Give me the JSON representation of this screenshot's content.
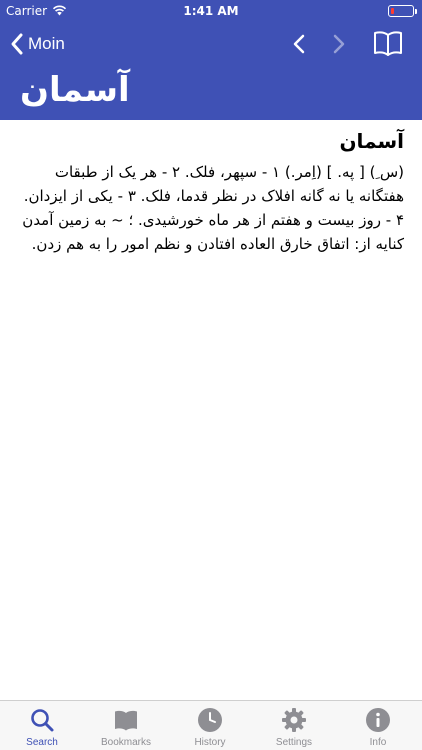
{
  "status_bar": {
    "carrier": "Carrier",
    "time": "1:41 AM",
    "battery_level": 0.15,
    "battery_color": "#ff3b30"
  },
  "nav": {
    "back_label": "Moin",
    "icons": [
      "chevron-left-icon",
      "chevron-left-icon",
      "chevron-right-icon",
      "book-open-icon"
    ]
  },
  "entry": {
    "title": "آسمان",
    "headword": "آسمان",
    "definition": "(س ِ) [ په. ] (اِمر.) ۱ -  سپهر، فلک. ۲ -  هر یک از طبقات هفتگانه یا نه گانه افلاک در نظر قدما، فلک. ۳ -  یکی از ایزدان. ۴ -  روز بیست و هفتم از هر ماه خورشیدی. ؛ ~ به زمین آمدن  کنایه از: اتفاق خارق العاده افتادن و نظم امور را به هم زدن."
  },
  "tabs": [
    {
      "label": "Search",
      "icon": "search-icon",
      "active": true
    },
    {
      "label": "Bookmarks",
      "icon": "bookmarks-icon",
      "active": false
    },
    {
      "label": "History",
      "icon": "clock-icon",
      "active": false
    },
    {
      "label": "Settings",
      "icon": "gear-icon",
      "active": false
    },
    {
      "label": "Info",
      "icon": "info-icon",
      "active": false
    }
  ],
  "colors": {
    "primary": "#3f51b5",
    "tab_inactive": "#8e8e93",
    "background": "#ffffff"
  }
}
